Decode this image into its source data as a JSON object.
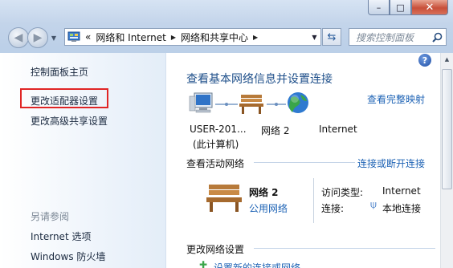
{
  "window": {
    "minimize": "–",
    "maximize": "□",
    "close": "✕"
  },
  "nav": {
    "back_icon": "back-arrow-icon",
    "forward_icon": "forward-arrow-icon"
  },
  "address": {
    "prefix": "«",
    "segments": [
      "网络和 Internet",
      "网络和共享中心"
    ]
  },
  "search": {
    "placeholder": "搜索控制面板"
  },
  "sidebar": {
    "items": [
      "控制面板主页",
      "更改适配器设置",
      "更改高级共享设置"
    ],
    "see_also_title": "另请参阅",
    "see_also": [
      "Internet 选项",
      "Windows 防火墙"
    ]
  },
  "main": {
    "title": "查看基本网络信息并设置连接",
    "full_map_link": "查看完整映射",
    "map": {
      "computer_line1": "USER-201...",
      "computer_line2": "(此计算机)",
      "network": "网络  2",
      "internet": "Internet"
    },
    "active_header": "查看活动网络",
    "connect_link": "连接或断开连接",
    "active_network": {
      "name": "网络  2",
      "type": "公用网络",
      "access_label": "访问类型:",
      "access_value": "Internet",
      "conn_label": "连接:",
      "conn_value": "本地连接"
    },
    "change_header": "更改网络设置",
    "partial_item": "设置新的连接或网络"
  },
  "colors": {
    "link": "#1e63b5",
    "title": "#1e4f8a",
    "highlight": "#e02525"
  }
}
